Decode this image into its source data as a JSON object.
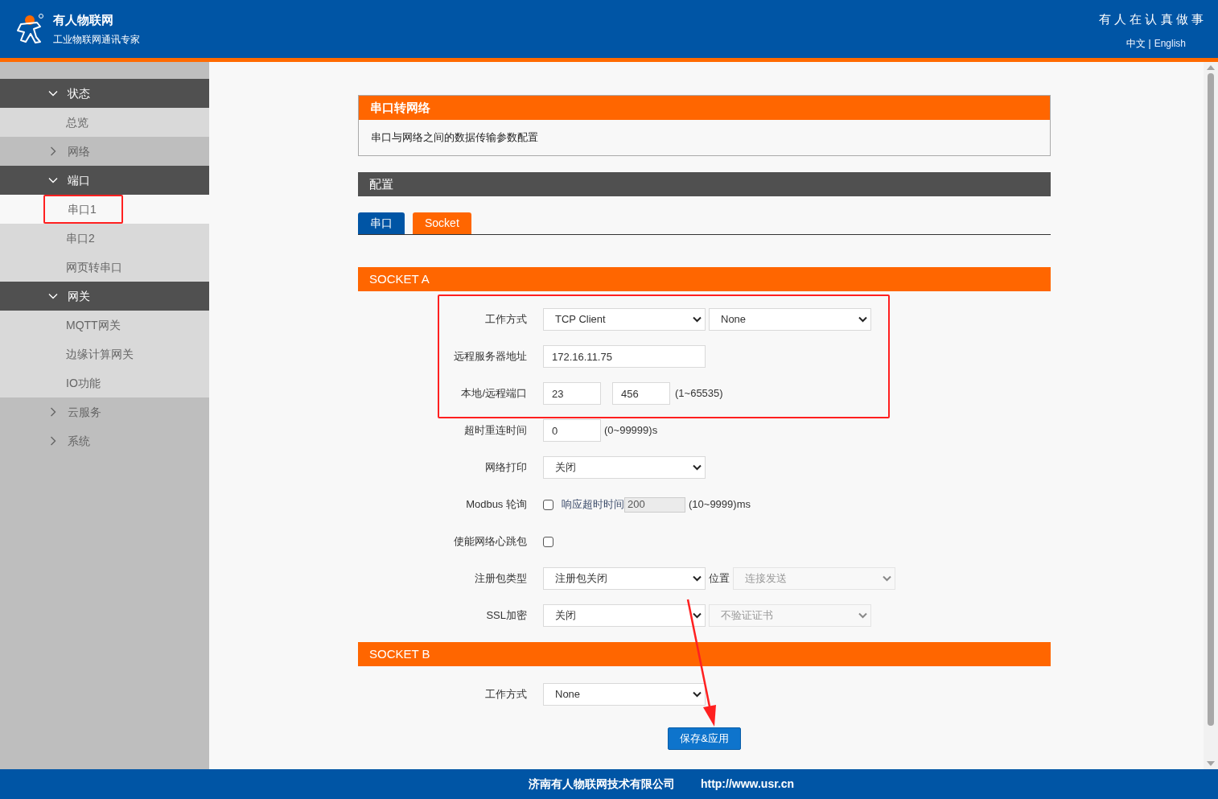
{
  "header": {
    "brand": "有人物联网",
    "tagline": "工业物联网通讯专家",
    "slogan": "有 人 在 认 真 做 事",
    "languages": [
      {
        "label": "中文",
        "selected": true
      },
      {
        "label": "English",
        "selected": false
      }
    ],
    "language_separator": "|"
  },
  "sidebar": {
    "groups": [
      {
        "label": "状态",
        "expanded": true,
        "children": [
          {
            "label": "总览",
            "selected": false,
            "highlighted": false
          }
        ]
      },
      {
        "label": "网络",
        "expanded": false
      },
      {
        "label": "端口",
        "expanded": true,
        "children": [
          {
            "label": "串口1",
            "selected": true,
            "highlighted": true
          },
          {
            "label": "串口2",
            "selected": false,
            "highlighted": false
          },
          {
            "label": "网页转串口",
            "selected": false,
            "highlighted": false
          }
        ]
      },
      {
        "label": "网关",
        "expanded": true,
        "children": [
          {
            "label": "MQTT网关",
            "selected": false,
            "highlighted": false
          },
          {
            "label": "边缘计算网关",
            "selected": false,
            "highlighted": false
          },
          {
            "label": "IO功能",
            "selected": false,
            "highlighted": false
          }
        ]
      },
      {
        "label": "云服务",
        "expanded": false
      },
      {
        "label": "系统",
        "expanded": false
      }
    ]
  },
  "intro": {
    "title": "串口转网络",
    "description": "串口与网络之间的数据传输参数配置"
  },
  "config_title": "配置",
  "tabs": [
    {
      "label": "串口",
      "selected": false
    },
    {
      "label": "Socket",
      "selected": true
    }
  ],
  "socket_a": {
    "title": "SOCKET A",
    "rows": [
      {
        "label": "工作方式",
        "highlighted": true,
        "controls": [
          {
            "kind": "select",
            "value": "TCP Client",
            "disabled": false
          },
          {
            "kind": "select",
            "value": "None",
            "disabled": false
          }
        ]
      },
      {
        "label": "远程服务器地址",
        "highlighted": true,
        "controls": [
          {
            "kind": "input",
            "value": "172.16.11.75",
            "disabled": false
          }
        ]
      },
      {
        "label": "本地/远程端口",
        "highlighted": true,
        "controls": [
          {
            "kind": "port",
            "value": "23",
            "disabled": false
          },
          {
            "kind": "port",
            "value": "456",
            "disabled": false
          },
          {
            "kind": "text",
            "text": "(1~65535)"
          }
        ]
      },
      {
        "label": "超时重连时间",
        "controls": [
          {
            "kind": "port",
            "value": "0",
            "disabled": false
          },
          {
            "kind": "text",
            "text": "(0~99999)s"
          }
        ]
      },
      {
        "label": "网络打印",
        "controls": [
          {
            "kind": "select",
            "value": "关闭",
            "disabled": false
          }
        ]
      },
      {
        "label": "Modbus 轮询",
        "controls": [
          {
            "kind": "checkbox",
            "checked": false
          },
          {
            "kind": "caption",
            "text": "响应超时时间"
          },
          {
            "kind": "small-input",
            "value": "200",
            "disabled": true
          },
          {
            "kind": "text",
            "text": "(10~9999)ms"
          }
        ]
      },
      {
        "label": "使能网络心跳包",
        "controls": [
          {
            "kind": "checkbox",
            "checked": false
          }
        ]
      },
      {
        "label": "注册包类型",
        "controls": [
          {
            "kind": "select",
            "value": "注册包关闭",
            "disabled": false
          },
          {
            "kind": "text",
            "text": "位置"
          },
          {
            "kind": "select",
            "value": "连接发送",
            "disabled": true
          }
        ]
      },
      {
        "label": "SSL加密",
        "controls": [
          {
            "kind": "select",
            "value": "关闭",
            "disabled": false
          },
          {
            "kind": "select",
            "value": "不验证证书",
            "disabled": true
          }
        ]
      }
    ]
  },
  "socket_b": {
    "title": "SOCKET B",
    "rows": [
      {
        "label": "工作方式",
        "controls": [
          {
            "kind": "select",
            "value": "None",
            "disabled": false
          }
        ]
      }
    ]
  },
  "save_button": "保存&应用",
  "footer": {
    "company": "济南有人物联网技术有限公司",
    "url": "http://www.usr.cn"
  }
}
